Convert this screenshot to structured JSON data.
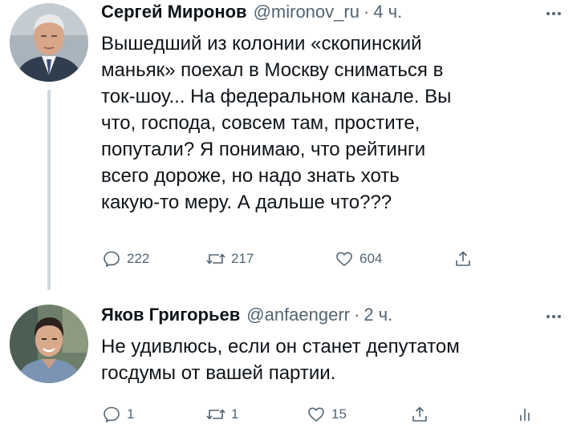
{
  "tweets": [
    {
      "author": "Сергей Миронов",
      "handle": "@mironov_ru",
      "separator": "·",
      "time": "4 ч.",
      "lines": [
        "Вышедший из колонии «скопинский",
        "маньяк» поехал в Москву сниматься в",
        "ток-шоу... На федеральном канале. Вы",
        "что, господа, совсем там, простите,",
        "попутали? Я понимаю, что рейтинги",
        "всего дороже, но надо знать хоть",
        "какую-то меру. А дальше что???"
      ],
      "replies": "222",
      "retweets": "217",
      "likes": "604",
      "icons": {
        "reply": "reply-icon",
        "retweet": "retweet-icon",
        "like": "heart-icon",
        "share": "share-icon",
        "more": "more-icon"
      }
    },
    {
      "author": "Яков Григорьев",
      "handle": "@anfaengerr",
      "separator": "·",
      "time": "2 ч.",
      "lines": [
        "Не удивлюсь, если он станет депутатом",
        "госдумы от вашей партии."
      ],
      "replies": "1",
      "retweets": "1",
      "likes": "15",
      "icons": {
        "reply": "reply-icon",
        "retweet": "retweet-icon",
        "like": "heart-icon",
        "share": "share-icon",
        "analytics": "analytics-icon",
        "more": "more-icon"
      }
    }
  ],
  "colors": {
    "text": "#0f1419",
    "secondary": "#536471",
    "thread_line": "#cfd9de",
    "background": "#ffffff"
  }
}
